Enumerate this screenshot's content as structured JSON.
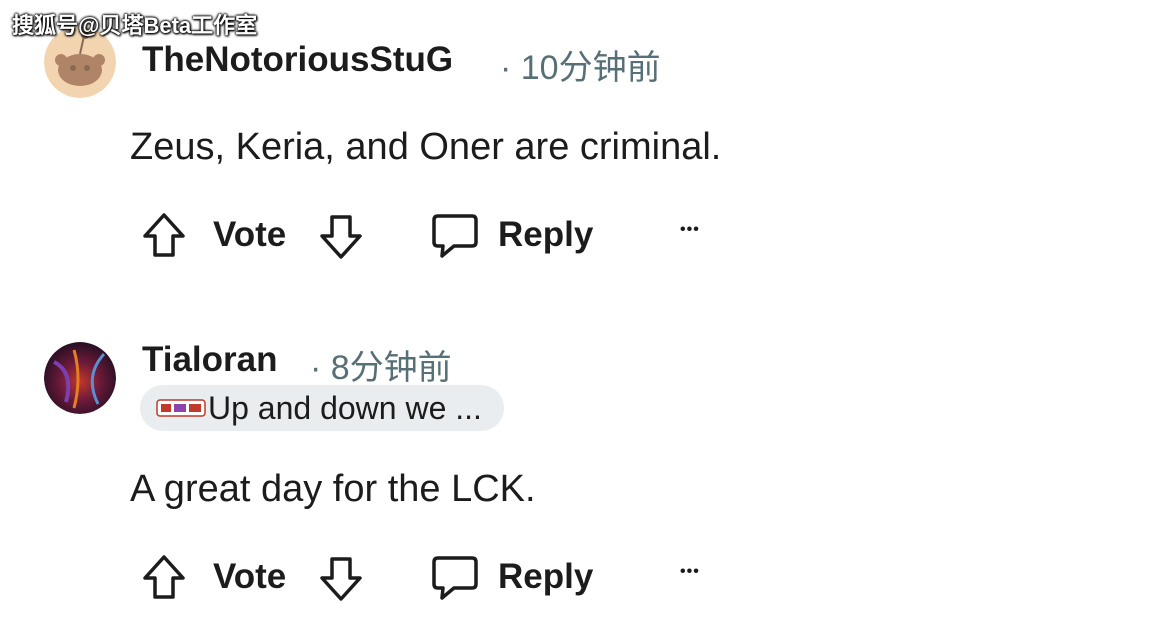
{
  "watermark": "搜狐号@贝塔Beta工作室",
  "comments": [
    {
      "author": "TheNotoriousStuG",
      "time": "· 10分钟前",
      "body": "Zeus, Keria, and Oner are criminal.",
      "actions": {
        "vote": "Vote",
        "reply": "Reply",
        "more": "•••"
      }
    },
    {
      "author": "Tialoran",
      "time": "· 8分钟前",
      "flair": "Up and down we ...",
      "body": "A great day for the LCK.",
      "actions": {
        "vote": "Vote",
        "reply": "Reply",
        "more": "•••"
      }
    }
  ],
  "colors": {
    "text": "#1c1c1c",
    "meta": "#576f76",
    "flair_bg": "#eaedef"
  }
}
